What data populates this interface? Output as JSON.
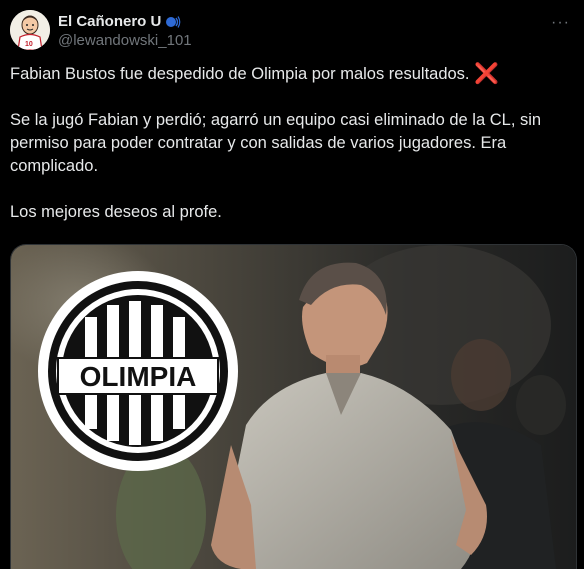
{
  "author": {
    "display_name": "El Cañonero U",
    "handle": "@lewandowski_101",
    "avatar_icon": "cartoon-player-avatar",
    "badge_icon": "speaking-head-emoji"
  },
  "more_icon": "more-horizontal-icon",
  "more_label": "···",
  "tweet": {
    "line1": "Fabian Bustos fue despedido de Olimpia por malos resultados.",
    "line1_emoji": "❌",
    "para2": "Se la jugó Fabian y perdió; agarró un equipo casi eliminado de la CL, sin permiso para poder contratar y con salidas de varios jugadores. Era complicado.",
    "para3": "Los mejores deseos al profe."
  },
  "media": {
    "logo_text": "OLIMPIA",
    "logo_icon": "olimpia-club-crest"
  },
  "colors": {
    "background": "#000000",
    "text": "#e7e9ea",
    "secondary": "#71767b",
    "cross": "#e0263b"
  }
}
